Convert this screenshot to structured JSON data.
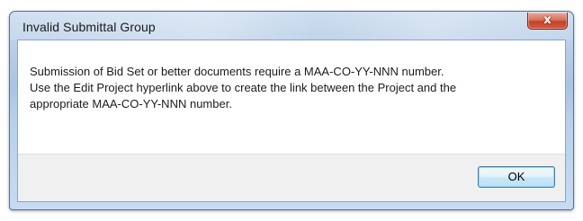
{
  "window": {
    "title": "Invalid Submittal Group",
    "close_glyph": "x"
  },
  "message": {
    "lines": [
      "Submission of Bid Set or better documents require a MAA-CO-YY-NNN number.",
      "Use the Edit Project hyperlink above to create the link between the Project and the",
      "appropriate MAA-CO-YY-NNN number."
    ]
  },
  "buttons": {
    "ok_label": "OK"
  },
  "icons": {
    "close": "close-icon"
  },
  "colors": {
    "close_button": "#c4442b",
    "frame": "#aac3e3",
    "footer": "#f0f0f0",
    "ok_border": "#3c7fb1"
  }
}
